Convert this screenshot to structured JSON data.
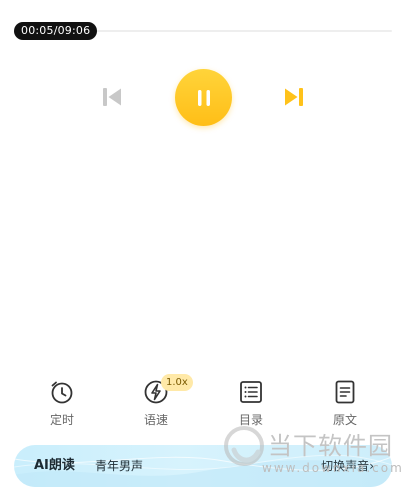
{
  "player": {
    "time": "00:05/09:06",
    "progress": 0.009
  },
  "controls": {
    "prev_icon": "skip-previous-icon",
    "pause_icon": "pause-icon",
    "next_icon": "skip-next-icon",
    "prev_color": "#c8c8c8",
    "next_color": "#ffc21a",
    "accent": "#ffc21a"
  },
  "tools": {
    "timer": {
      "label": "定时",
      "icon": "alarm-clock-icon"
    },
    "speed": {
      "label": "语速",
      "icon": "lightning-icon",
      "badge": "1.0x"
    },
    "toc": {
      "label": "目录",
      "icon": "list-icon"
    },
    "original": {
      "label": "原文",
      "icon": "document-icon"
    }
  },
  "ai_bar": {
    "title": "AI朗读",
    "voice": "青年男声",
    "switch_label": "切换声音",
    "chevron": "›"
  },
  "watermark": {
    "line1": "当下软件园",
    "line2": "www.downxia.com"
  }
}
